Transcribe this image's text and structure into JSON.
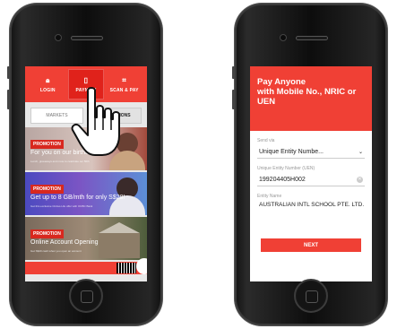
{
  "left_screen": {
    "top_bar": [
      {
        "label": "LOGIN",
        "icon": "lock-icon"
      },
      {
        "label": "PAYNOW",
        "icon": "paynow-icon"
      },
      {
        "label": "SCAN & PAY",
        "icon": "scan-icon"
      }
    ],
    "tabs": [
      "MARKETS",
      "PROMOTIONS"
    ],
    "promotions": [
      {
        "tag": "PROMOTION",
        "title": "For you on our birthday",
        "subtitle": "Lunch, giveaways and more to celebrate our 50th"
      },
      {
        "tag": "PROMOTION",
        "title": "Get up to 8 GB/mth for only S$28!",
        "subtitle": "Get this exclusive Circles.Life offer with OCBC Bank"
      },
      {
        "tag": "PROMOTION",
        "title": "Online Account Opening",
        "subtitle": "Get S$20 cash when you open an account"
      }
    ],
    "colors": {
      "brand_red": "#f04035"
    }
  },
  "right_screen": {
    "header_line1": "Pay Anyone",
    "header_line2": "with Mobile No., NRIC or",
    "header_line3": "UEN",
    "send_via_label": "Send via",
    "send_via_value": "Unique Entity Numbe...",
    "uen_label": "Unique Entity Number (UEN)",
    "uen_value": "199204405H002",
    "entity_name_label": "Entity Name",
    "entity_name_value": "AUSTRALIAN INTL   SCHOOL PTE. LTD.",
    "next_label": "NEXT"
  }
}
